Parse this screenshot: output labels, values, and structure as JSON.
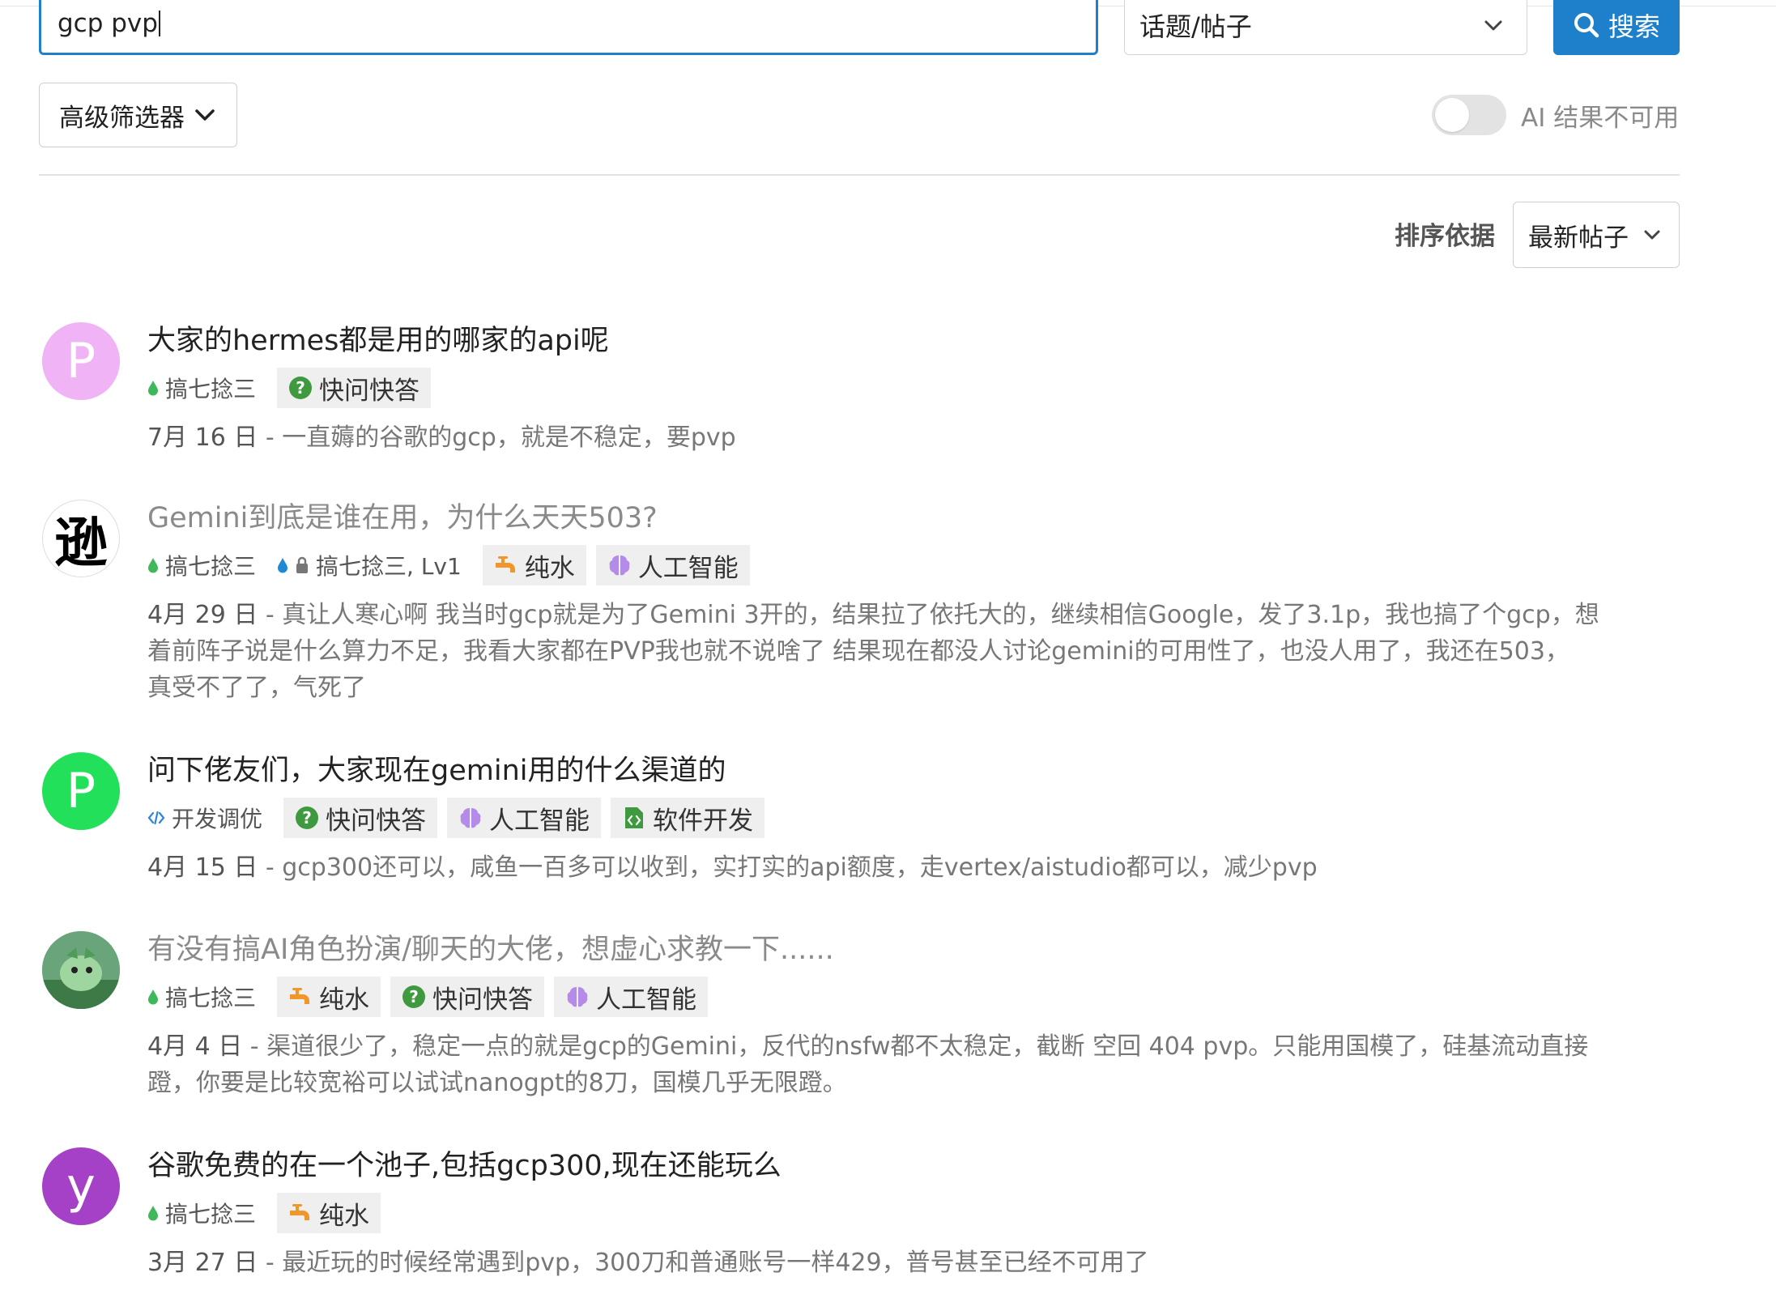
{
  "search": {
    "query": "gcp pvp",
    "type_label": "话题/帖子",
    "button_label": "搜索"
  },
  "filters": {
    "advanced_label": "高级筛选器",
    "ai_label": "AI 结果不可用",
    "ai_enabled": false
  },
  "sort": {
    "label": "排序依据",
    "value": "最新帖子"
  },
  "results": [
    {
      "avatar_letter": "P",
      "avatar_color": "#f0b3f5",
      "title": "大家的hermes都是用的哪家的api呢",
      "visited": false,
      "category": "搞七捻三",
      "category_color": "#3fb85c",
      "tags": [
        "快问快答"
      ],
      "date": "7月 16 日",
      "excerpt_lines": [
        "一直薅的谷歌的gcp，就是不稳定，要pvp"
      ]
    },
    {
      "avatar_letter": "逊",
      "avatar_color": "#ffffff",
      "title": "Gemini到底是谁在用，为什么天天503?",
      "visited": true,
      "category": "搞七捻三",
      "category_color": "#3fb85c",
      "subcategory": "搞七捻三, Lv1",
      "tags": [
        "纯水",
        "人工智能"
      ],
      "date": "4月 29 日",
      "excerpt_lines": [
        "真让人寒心啊 我当时gcp就是为了Gemini 3开的，结果拉了依托大的，继续相信Google，发了3.1p，我也搞了个gcp，想",
        "着前阵子说是什么算力不足，我看大家都在PVP我也就不说啥了 结果现在都没人讨论gemini的可用性了，也没人用了，我还在503，",
        "真受不了了，气死了"
      ]
    },
    {
      "avatar_letter": "P",
      "avatar_color": "#22e05a",
      "title": "问下佬友们，大家现在gemini用的什么渠道的",
      "visited": false,
      "category": "开发调优",
      "category_color": "#2f86d6",
      "tags": [
        "快问快答",
        "人工智能",
        "软件开发"
      ],
      "date": "4月 15 日",
      "excerpt_lines": [
        "gcp300还可以，咸鱼一百多可以收到，实打实的api额度，走vertex/aistudio都可以，减少pvp"
      ]
    },
    {
      "avatar_letter": "",
      "avatar_color": "#7fb88a",
      "title": "有没有搞AI角色扮演/聊天的大佬，想虚心求教一下......",
      "visited": true,
      "category": "搞七捻三",
      "category_color": "#3fb85c",
      "tags": [
        "纯水",
        "快问快答",
        "人工智能"
      ],
      "date": "4月 4 日",
      "excerpt_lines": [
        "渠道很少了，稳定一点的就是gcp的Gemini，反代的nsfw都不太稳定，截断 空回 404 pvp。只能用国模了，硅基流动直接",
        "蹬，你要是比较宽裕可以试试nanogpt的8刀，国模几乎无限蹬。"
      ]
    },
    {
      "avatar_letter": "y",
      "avatar_color": "#a541c7",
      "title": "谷歌免费的在一个池子,包括gcp300,现在还能玩么",
      "visited": false,
      "category": "搞七捻三",
      "category_color": "#3fb85c",
      "tags": [
        "纯水"
      ],
      "date": "3月 27 日",
      "excerpt_lines": [
        "最近玩的时候经常遇到pvp，300刀和普通账号一样429，普号甚至已经不可用了"
      ]
    }
  ],
  "tag_icons": {
    "快问快答": {
      "icon": "question-circle-icon",
      "color": "#3f9a3f"
    },
    "人工智能": {
      "icon": "brain-icon",
      "color": "#b48be8"
    },
    "纯水": {
      "icon": "faucet-icon",
      "color": "#f0962a"
    },
    "软件开发": {
      "icon": "code-file-icon",
      "color": "#3f9a3f"
    }
  }
}
